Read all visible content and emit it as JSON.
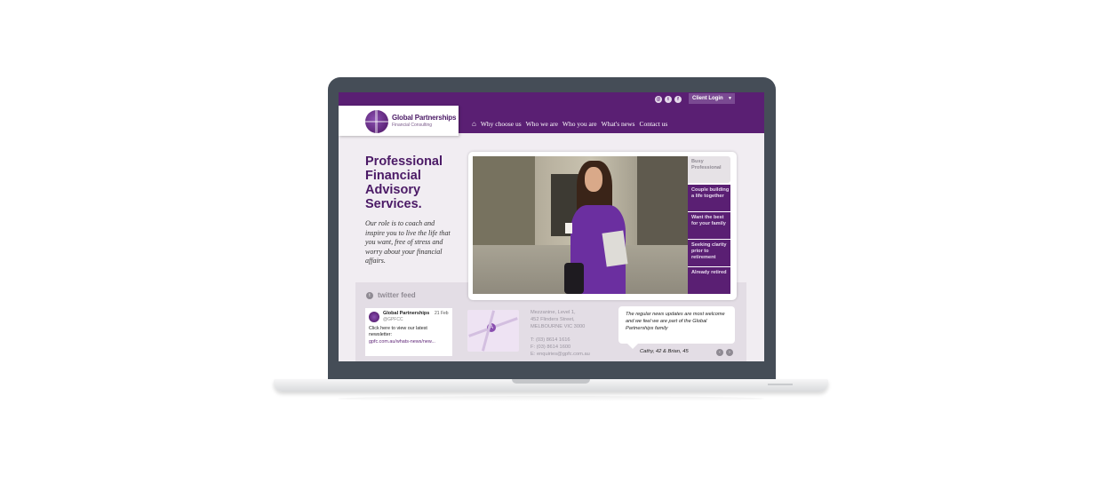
{
  "header": {
    "social_icons": [
      "email-icon",
      "twitter-icon",
      "facebook-icon"
    ],
    "social_glyphs": {
      "email": "@",
      "twitter": "t",
      "facebook": "f"
    },
    "client_login": "Client Login",
    "login_arrow": "▼",
    "logo": {
      "name": "Global Partnerships",
      "subtitle": "Financial Consulting"
    },
    "nav": {
      "home_glyph": "⌂",
      "items": [
        "Why choose us",
        "Who we are",
        "Who you are",
        "What's news",
        "Contact us"
      ]
    }
  },
  "hero": {
    "headline": "Professional Financial Advisory Services.",
    "intro": "Our role is to coach and inspire you to live the life that you want, free of stress and worry about your financial affairs.",
    "tabs": [
      "Busy Professional",
      "Couple building a life together",
      "Want the best for your family",
      "Seeking clarity prior to retirement",
      "Already retired"
    ],
    "active_tab": "Busy Professional"
  },
  "twitter": {
    "heading": "twitter feed",
    "icon_glyph": "t",
    "tweet": {
      "name": "Global Partnerships",
      "handle": "@GPFCC",
      "date": "21 Feb",
      "text": "Click here to view our latest newsletter:",
      "link": "gpfc.com.au/whats-news/new..."
    }
  },
  "contact": {
    "map_pin": "A",
    "address": [
      "Mezzanine, Level 1,",
      "452 Flinders Street,",
      "MELBOURNE VIC 3000"
    ],
    "phone": "T: (03) 8614 1616",
    "fax": "F: (03) 8614 1600",
    "email": "E: enquiries@gpfc.com.au"
  },
  "testimonial": {
    "text": "The regular news updates are most welcome and we feel we are part of the Global Partnerships family",
    "author": "Cathy, 42 & Brian, 45",
    "prev_glyph": "‹",
    "next_glyph": "›"
  },
  "colors": {
    "brand_purple": "#5a1f73",
    "background": "#f1edf2"
  }
}
